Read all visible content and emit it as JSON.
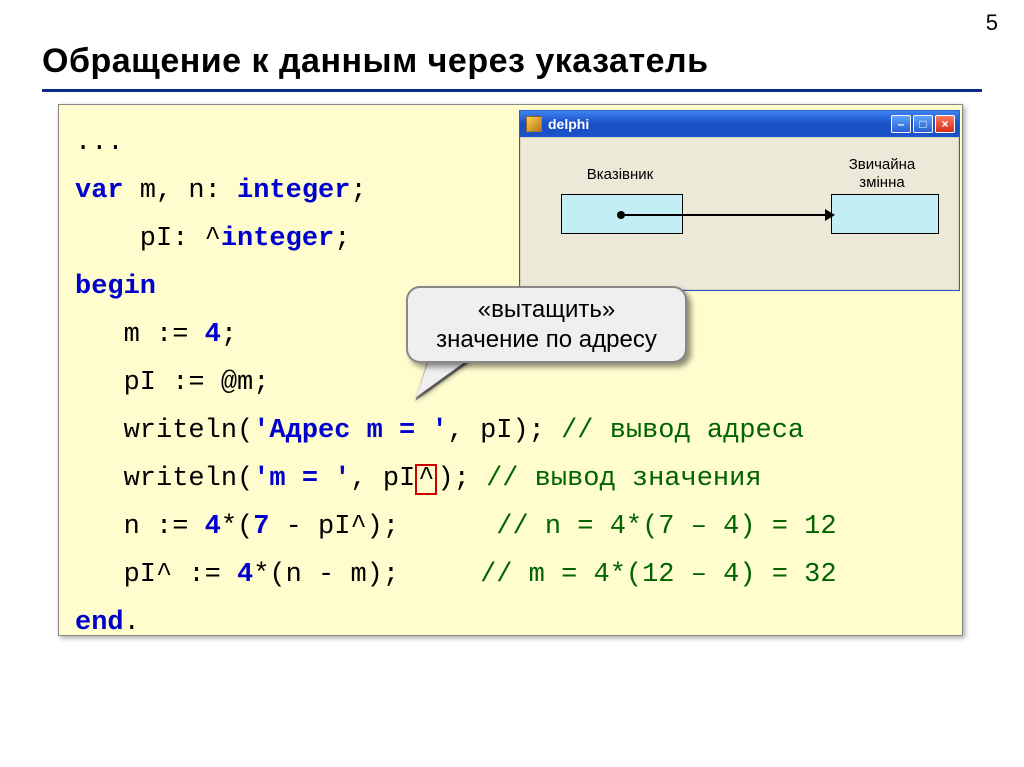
{
  "page_number": "5",
  "title": "Обращение к данным через указатель",
  "code": {
    "l1": "...",
    "l2a": "var",
    "l2b": " m, n: ",
    "l2c": "integer",
    "l2d": ";",
    "l3a": "    pI: ^",
    "l3b": "integer",
    "l3c": ";",
    "l4": "begin",
    "l5a": "   m := ",
    "l5b": "4",
    "l5c": ";",
    "l6": "   pI := @m;",
    "l7a": "   writeln(",
    "l7b": "'Адрес m = '",
    "l7c": ", pI); ",
    "l7d": "// вывод адреса",
    "l8a": "   writeln(",
    "l8b": "'m = '",
    "l8c": ", pI",
    "l8caret": "^",
    "l8d": "); ",
    "l8e": "// вывод значения",
    "l9a": "   n := ",
    "l9b": "4",
    "l9c": "*(",
    "l9d": "7",
    "l9e": " - pI^);      ",
    "l9f": "// n = 4*(7 – 4) = 12",
    "l10a": "   pI^ := ",
    "l10b": "4",
    "l10c": "*(n - m);     ",
    "l10d": "// m = 4*(12 – 4) = 32",
    "l11a": "end",
    "l11b": "."
  },
  "window": {
    "title": "delphi",
    "label_pointer": "Вказівник",
    "label_variable_l1": "Звичайна",
    "label_variable_l2": "змінна"
  },
  "callout": {
    "line1": "«вытащить»",
    "line2": "значение по адресу"
  }
}
